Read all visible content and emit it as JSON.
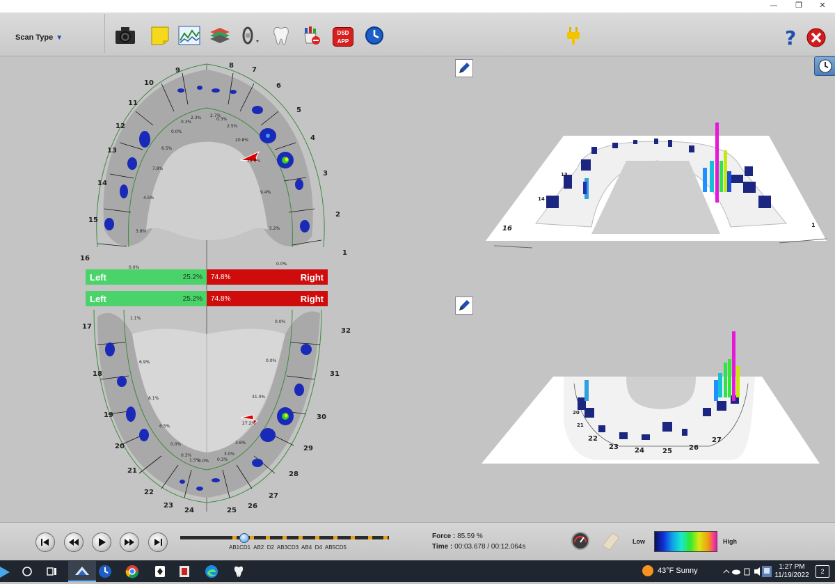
{
  "window": {
    "minimize": "—",
    "restore": "❐",
    "close": "✕"
  },
  "toolbar": {
    "scan_type_label": "Scan Type",
    "icons": [
      "camera-icon",
      "notes-icon",
      "graph-icon",
      "layers-icon",
      "occlusion-icon",
      "tooth-icon",
      "sensor-icon",
      "dsd-app-icon",
      "clock-app-icon",
      "connection-plug-icon",
      "help-icon",
      "close-app-icon"
    ],
    "dsd_logo": "DSD APP"
  },
  "arch_view": {
    "upper_tooth_numbers": [
      "1",
      "2",
      "3",
      "4",
      "5",
      "6",
      "7",
      "8",
      "9",
      "10",
      "11",
      "12",
      "13",
      "14",
      "15",
      "16"
    ],
    "lower_tooth_numbers": [
      "17",
      "18",
      "19",
      "20",
      "21",
      "22",
      "23",
      "24",
      "25",
      "26",
      "27",
      "28",
      "29",
      "30",
      "31",
      "32"
    ],
    "upper_percentages": [
      "2.3%",
      "2.7%",
      "0.3%",
      "0.3%",
      "2.5%",
      "0.0%",
      "20.8%",
      "6.5%",
      "28.8%",
      "7.8%",
      "9.4%",
      "4.5%",
      "5.2%",
      "3.8%",
      "0.0%",
      "0.0%"
    ],
    "lower_percentages": [
      "1.1%",
      "0.0%",
      "6.9%",
      "0.0%",
      "8.1%",
      "31.0%",
      "6.5%",
      "27.2%",
      "0.0%",
      "3.6%",
      "0.3%",
      "1.5%",
      "0.0%",
      "0.3%",
      "3.0%"
    ],
    "balance_bars": [
      {
        "left_label": "Left",
        "left_value": "25.2%",
        "right_value": "74.8%",
        "right_label": "Right"
      },
      {
        "left_label": "Left",
        "left_value": "25.2%",
        "right_value": "74.8%",
        "right_label": "Right"
      }
    ]
  },
  "views3d": {
    "upper_labels": [
      "16",
      "1",
      "14",
      "13"
    ],
    "lower_labels": [
      "22",
      "23",
      "24",
      "25",
      "26",
      "27",
      "20",
      "21"
    ]
  },
  "playback": {
    "timeline_labels": [
      "AB",
      "1C",
      "D1",
      "AB",
      "2",
      "D2",
      "AB",
      "3",
      "C",
      "3",
      "AB",
      "4",
      "D4",
      "AB",
      "5",
      "C5",
      "D5"
    ],
    "timeline_text": "AB1CD1  AB2  D2  AB3CD3  AB4  D4  AB5CD5",
    "force_label": "Force :",
    "force_value": "85.59 %",
    "time_label": "Time :",
    "time_value": "00:03.678 / 00:12.064s",
    "legend_low": "Low",
    "legend_high": "High"
  },
  "taskbar": {
    "weather": "43°F  Sunny",
    "time": "1:27 PM",
    "date": "11/19/2022",
    "notifications": "2"
  },
  "colors": {
    "left_green": "#49d36a",
    "right_red": "#d00b0b",
    "arch_outline": "#3e8a3e"
  }
}
